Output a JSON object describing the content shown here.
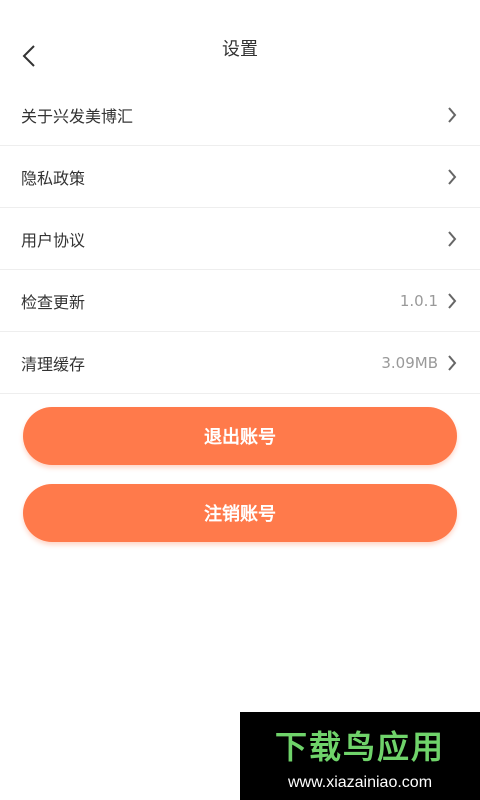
{
  "header": {
    "title": "设置",
    "back_icon": "chevron-left-icon"
  },
  "menu": [
    {
      "label": "关于兴发美博汇",
      "value": ""
    },
    {
      "label": "隐私政策",
      "value": ""
    },
    {
      "label": "用户协议",
      "value": ""
    },
    {
      "label": "检查更新",
      "value": "1.0.1"
    },
    {
      "label": "清理缓存",
      "value": "3.09MB"
    }
  ],
  "buttons": {
    "logout": "退出账号",
    "cancel_account": "注销账号"
  },
  "watermark": {
    "title": "下载鸟应用",
    "url": "www.xiazainiao.com"
  },
  "colors": {
    "accent": "#ff7a4b",
    "text": "#333333",
    "secondary_text": "#999999",
    "divider": "#eeeeee",
    "watermark_green": "#6fd36a"
  }
}
